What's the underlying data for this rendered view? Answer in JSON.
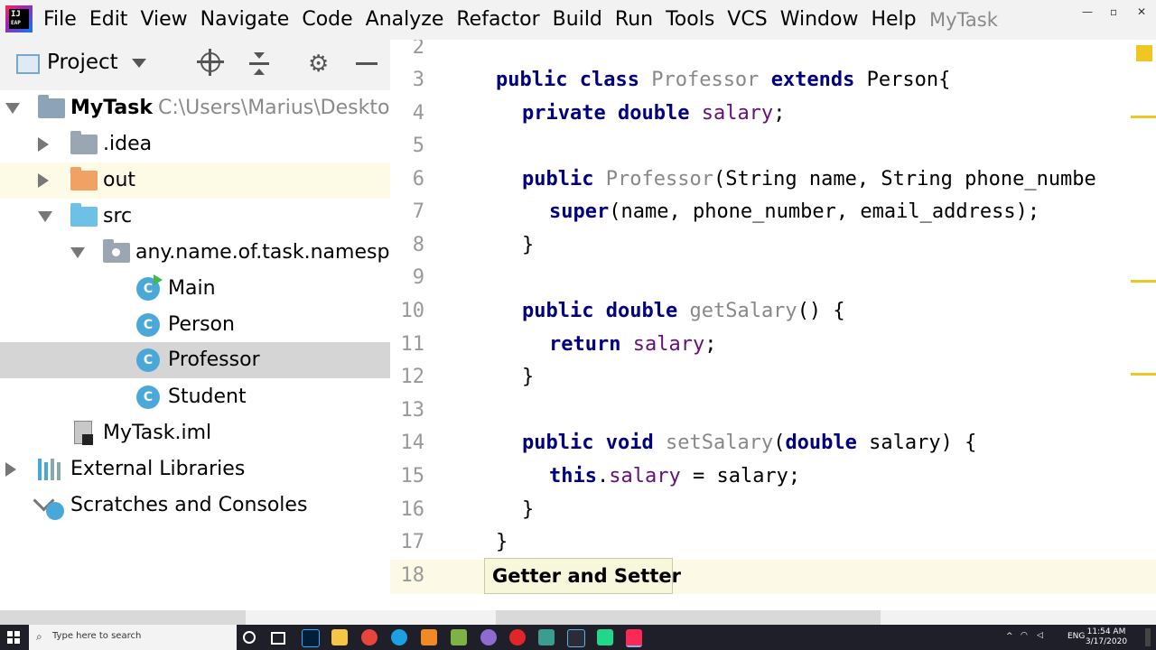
{
  "menubar": {
    "logo_text_top": "IJ",
    "logo_text_bottom": "EAP",
    "items": [
      "File",
      "Edit",
      "View",
      "Navigate",
      "Code",
      "Analyze",
      "Refactor",
      "Build",
      "Run",
      "Tools",
      "VCS",
      "Window",
      "Help"
    ],
    "window_title": "MyTask"
  },
  "project_panel": {
    "title": "Project",
    "tree": [
      {
        "label": "MyTask",
        "path": "C:\\Users\\Marius\\Desktop",
        "icon": "module-folder-icon",
        "expanded": true
      },
      {
        "label": ".idea",
        "icon": "folder-icon",
        "expanded": false
      },
      {
        "label": "out",
        "icon": "excluded-folder-icon",
        "expanded": false
      },
      {
        "label": "src",
        "icon": "source-folder-icon",
        "expanded": true
      },
      {
        "label": "any.name.of.task.namespace",
        "icon": "package-icon",
        "expanded": true
      },
      {
        "label": "Main",
        "icon": "class-run-icon"
      },
      {
        "label": "Person",
        "icon": "class-icon"
      },
      {
        "label": "Professor",
        "icon": "class-icon"
      },
      {
        "label": "Student",
        "icon": "class-icon"
      },
      {
        "label": "MyTask.iml",
        "icon": "iml-file-icon"
      },
      {
        "label": "External Libraries",
        "icon": "libraries-icon",
        "expanded": false
      },
      {
        "label": "Scratches and Consoles",
        "icon": "scratches-icon"
      }
    ]
  },
  "editor": {
    "line_numbers": [
      "2",
      "3",
      "4",
      "5",
      "6",
      "7",
      "8",
      "9",
      "10",
      "11",
      "12",
      "13",
      "14",
      "15",
      "16",
      "17",
      "18"
    ],
    "code": {
      "l3_kw1": "public",
      "l3_kw2": "class",
      "l3_name": "Professor",
      "l3_kw3": "extends",
      "l3_rest": "Person{",
      "l4_kw1": "private",
      "l4_kw2": "double",
      "l4_field": "salary",
      "l4_rest": ";",
      "l6_kw1": "public",
      "l6_name": "Professor",
      "l6_rest": "(String name, String phone_numbe",
      "l7_kw1": "super",
      "l7_rest": "(name, phone_number, email_address);",
      "l8": "}",
      "l10_kw1": "public",
      "l10_kw2": "double",
      "l10_name": "getSalary",
      "l10_rest": "() {",
      "l11_kw1": "return",
      "l11_field": "salary",
      "l11_rest": ";",
      "l12": "}",
      "l14_kw1": "public",
      "l14_kw2": "void",
      "l14_name": "setSalary",
      "l14_p1": "(",
      "l14_kw3": "double",
      "l14_rest": " salary) {",
      "l15_kw1": "this",
      "l15_dot": ".",
      "l15_field": "salary",
      "l15_rest": " = salary;",
      "l16": "}",
      "l17": "}"
    },
    "tooltip": "Getter and Setter"
  },
  "taskbar": {
    "search_placeholder": "Type here to search",
    "tray_lang": "ENG",
    "time": "11:54 AM",
    "date": "3/17/2020"
  },
  "colors": {
    "keyword": "#000080",
    "field": "#660e7a",
    "unused_name": "#888888",
    "marker": "#f0c623"
  }
}
